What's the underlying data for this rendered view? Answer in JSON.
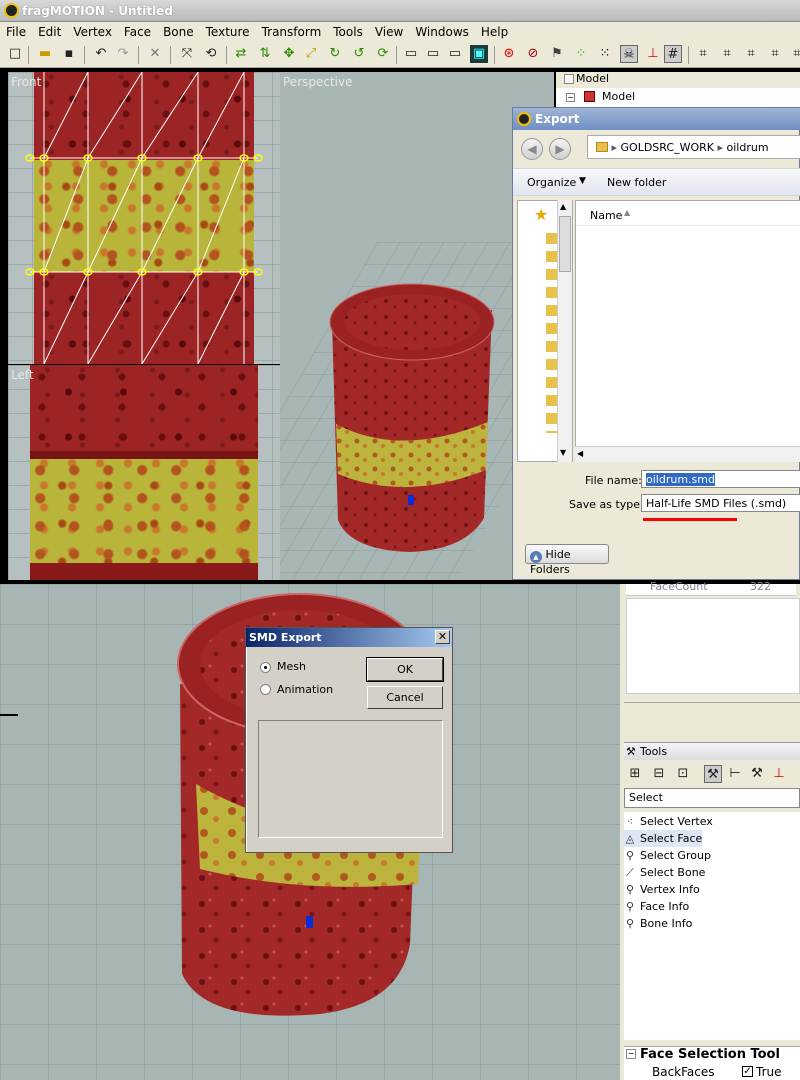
{
  "app": {
    "title": "fragMOTION - Untitled"
  },
  "menu": [
    "File",
    "Edit",
    "Vertex",
    "Face",
    "Bone",
    "Texture",
    "Transform",
    "Tools",
    "View",
    "Windows",
    "Help"
  ],
  "viewports": {
    "front": "Front",
    "left": "Left",
    "perspective": "Perspective"
  },
  "model_panel": {
    "header": "Model",
    "tree_root": "Model"
  },
  "export_dialog": {
    "title": "Export",
    "breadcrumb": [
      "GOLDSRC_WORK",
      "oildrum"
    ],
    "organize_label": "Organize",
    "new_folder_label": "New folder",
    "column_name": "Name",
    "file_name_label": "File name:",
    "file_name_value": "oildrum.smd",
    "save_type_label": "Save as type:",
    "save_type_value": "Half-Life SMD Files (.smd)",
    "hide_folders_label": "Hide Folders"
  },
  "smd_dialog": {
    "title": "SMD Export",
    "mesh_label": "Mesh",
    "animation_label": "Animation",
    "ok_label": "OK",
    "cancel_label": "Cancel",
    "selected": "Mesh"
  },
  "properties": {
    "facecount_label": "FaceCount",
    "facecount_value": "322"
  },
  "tools_panel": {
    "header": "Tools",
    "select_value": "Select",
    "items": [
      "Select Vertex",
      "Select Face",
      "Select Group",
      "Select Bone",
      "Vertex Info",
      "Face Info",
      "Bone Info"
    ],
    "selected_item": "Select Face"
  },
  "face_selection_tool": {
    "header": "Face Selection Tool",
    "backfaces_label": "BackFaces",
    "backfaces_value": "True",
    "backfaces_checked": true
  },
  "colors": {
    "highlight_underline": "#ff0000",
    "selection_blue": "#316ac5",
    "vertex_yellow": "#ffff00"
  }
}
